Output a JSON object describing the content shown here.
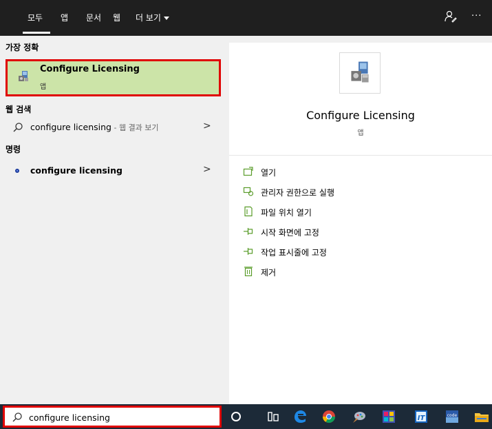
{
  "topbar": {
    "tabs": [
      "모두",
      "앱",
      "문서",
      "웹",
      "더 보기"
    ],
    "more_label": "···"
  },
  "results": {
    "best_match_title": "가장 정확",
    "best_match": {
      "name": "Configure Licensing",
      "type": "앱"
    },
    "web_title": "웹 검색",
    "web_item": {
      "query": "configure licensing",
      "suffix": " - 웹 결과 보기"
    },
    "command_title": "명령",
    "command_item": {
      "name": "configure licensing"
    }
  },
  "preview": {
    "title": "Configure Licensing",
    "subtitle": "앱",
    "actions": [
      {
        "label": "열기",
        "icon": "open-icon"
      },
      {
        "label": "관리자 권한으로 실행",
        "icon": "run-as-admin-icon"
      },
      {
        "label": "파일 위치 열기",
        "icon": "file-location-icon"
      },
      {
        "label": "시작 화면에 고정",
        "icon": "pin-start-icon"
      },
      {
        "label": "작업 표시줄에 고정",
        "icon": "pin-taskbar-icon"
      },
      {
        "label": "제거",
        "icon": "uninstall-icon"
      }
    ]
  },
  "search": {
    "value": "configure licensing"
  },
  "colors": {
    "highlight": "#cce4a8",
    "red_border": "#e00000",
    "topbar": "#1f1f1f",
    "taskbar": "#1c2a38"
  }
}
